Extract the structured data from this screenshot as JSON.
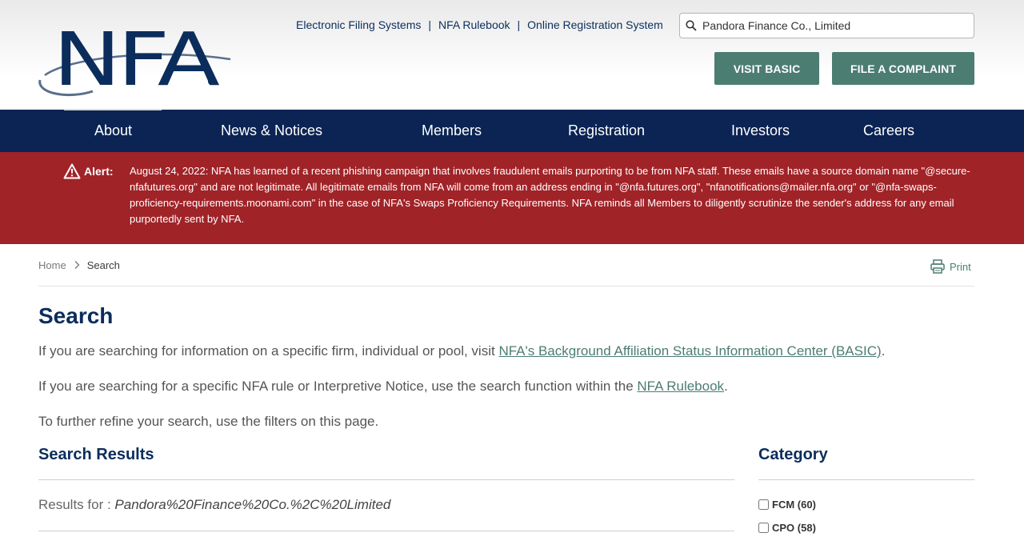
{
  "header": {
    "logo_text": "NFA",
    "top_links": [
      "Electronic Filing Systems",
      "NFA Rulebook",
      "Online Registration System"
    ],
    "separator": "|",
    "search": {
      "value": "Pandora Finance Co., Limited",
      "placeholder": ""
    },
    "buttons": {
      "visit_basic": "VISIT BASIC",
      "file_complaint": "FILE A COMPLAINT"
    },
    "brand_color": "#0b2d5c",
    "accent_color": "#4c7d72"
  },
  "nav": {
    "items": [
      "About",
      "News & Notices",
      "Members",
      "Registration",
      "Investors",
      "Careers"
    ],
    "background": "#0b2454"
  },
  "alert": {
    "title": "Alert:",
    "text": "August 24, 2022: NFA has learned of a recent phishing campaign that involves fraudulent emails purporting to be from NFA staff. These emails have a source domain name \"@secure-nfafutures.org\" and are not legitimate. All legitimate emails from NFA will come from an address ending in \"@nfa.futures.org\", \"nfanotifications@mailer.nfa.org\" or \"@nfa-swaps-proficiency-requirements.moonami.com\" in the case of NFA's Swaps Proficiency Requirements. NFA reminds all Members to diligently scrutinize the sender's address for any email purportedly sent by NFA.",
    "background": "#a02328",
    "icon": "warning-icon"
  },
  "breadcrumb": {
    "home": "Home",
    "current": "Search"
  },
  "print_label": "Print",
  "main": {
    "title": "Search",
    "p1_before": "If you are searching for information on a specific firm, individual or pool, visit ",
    "p1_link": "NFA's Background Affiliation Status Information Center (BASIC)",
    "p1_after": ".",
    "p2_before": "If you are searching for a specific NFA rule or Interpretive Notice, use the search function within the ",
    "p2_link": "NFA Rulebook",
    "p2_after": ".",
    "p3": "To further refine your search, use the filters on this page.",
    "results_title": "Search Results",
    "results_for_label": "Results for : ",
    "results_query": "Pandora%20Finance%20Co.%2C%20Limited"
  },
  "category": {
    "title": "Category",
    "items": [
      {
        "label": "FCM",
        "count": "(60)"
      },
      {
        "label": "CPO",
        "count": "(58)"
      }
    ]
  }
}
